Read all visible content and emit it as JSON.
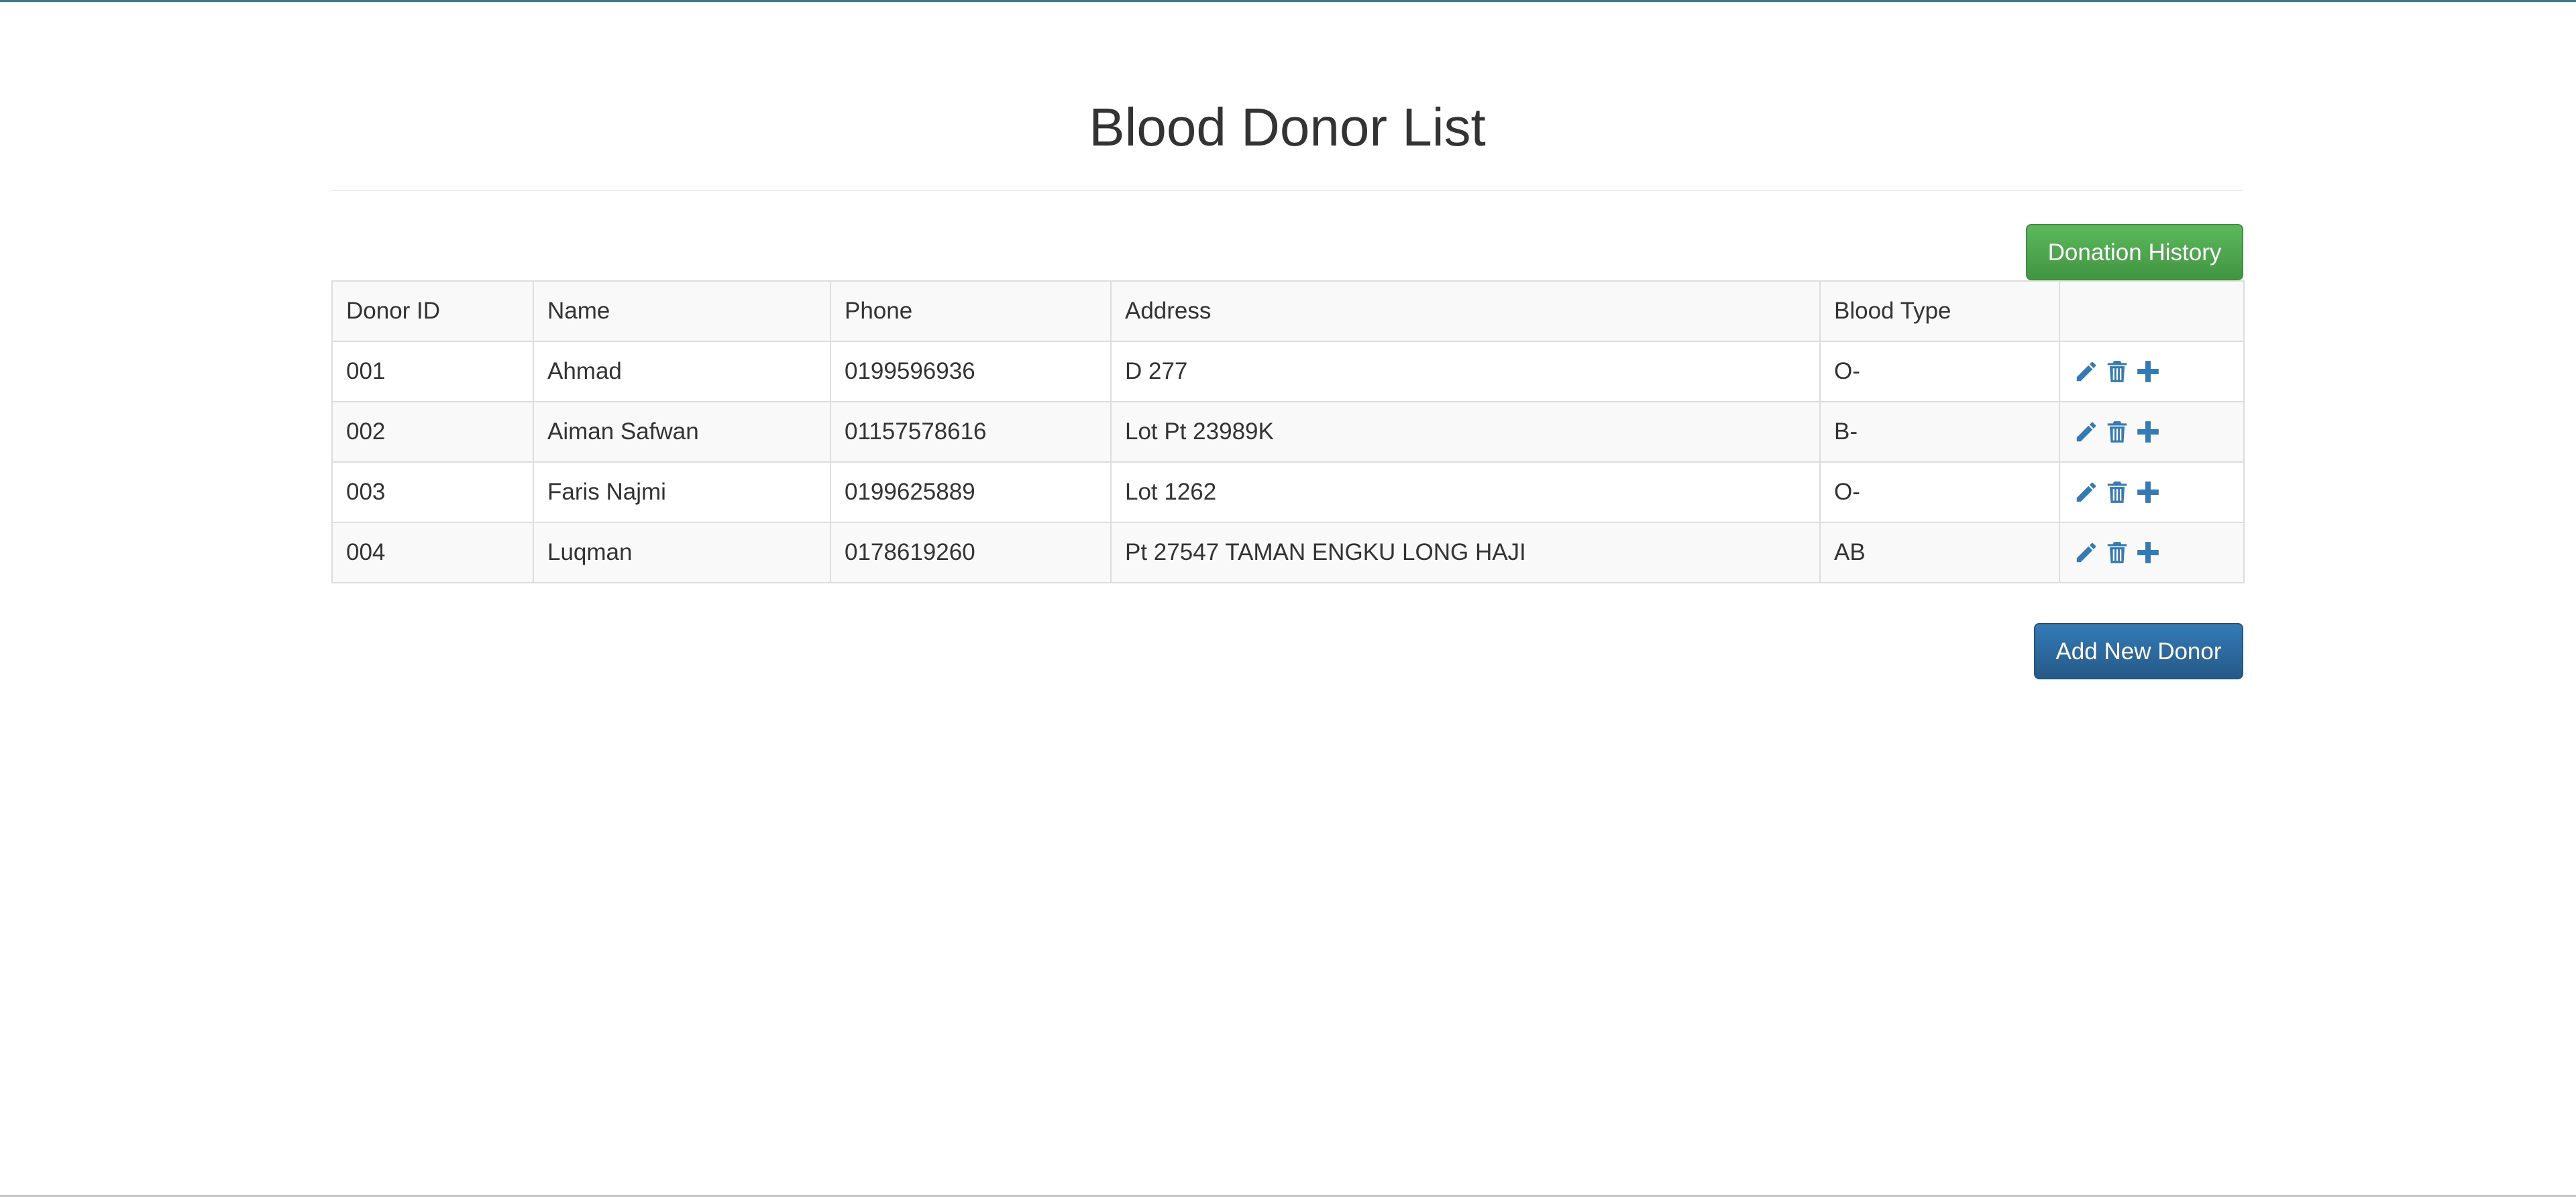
{
  "page": {
    "title": "Blood Donor List"
  },
  "toolbar": {
    "donation_history_label": "Donation History",
    "add_new_donor_label": "Add New Donor"
  },
  "table": {
    "headers": [
      "Donor ID",
      "Name",
      "Phone",
      "Address",
      "Blood Type",
      ""
    ],
    "rows": [
      {
        "id": "001",
        "name": "Ahmad",
        "phone": "0199596936",
        "address": "D 277",
        "blood_type": "O-"
      },
      {
        "id": "002",
        "name": "Aiman Safwan",
        "phone": "01157578616",
        "address": "Lot Pt 23989K",
        "blood_type": "B-"
      },
      {
        "id": "003",
        "name": "Faris Najmi",
        "phone": "0199625889",
        "address": "Lot 1262",
        "blood_type": "O-"
      },
      {
        "id": "004",
        "name": "Luqman",
        "phone": "0178619260",
        "address": "Pt 27547 TAMAN ENGKU LONG HAJI",
        "blood_type": "AB"
      }
    ],
    "row_actions": [
      "pencil-icon",
      "trash-icon",
      "plus-icon"
    ]
  },
  "colors": {
    "success_button": "#5cb85c",
    "primary_button": "#337ab7",
    "icon": "#337ab7",
    "stripe": "#f9f9f9",
    "border": "#dddddd"
  }
}
